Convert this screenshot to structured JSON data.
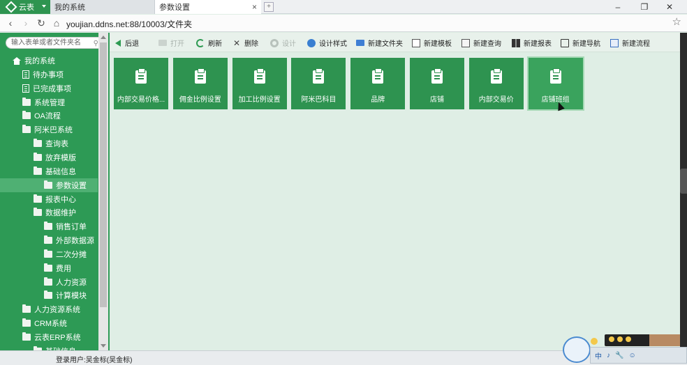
{
  "browser": {
    "app_tab_label": "云表",
    "tabs": [
      {
        "label": "我的系统"
      },
      {
        "label": "参数设置"
      }
    ],
    "close_glyph": "×",
    "address": "youjian.ddns.net:88/10003/文件夹"
  },
  "sidebar": {
    "search_placeholder": "输入表单或者文件夹名",
    "tree": [
      {
        "label": "我的系统",
        "icon": "home-icon",
        "level": 0
      },
      {
        "label": "待办事项",
        "icon": "doc-icon",
        "level": 1
      },
      {
        "label": "已完成事项",
        "icon": "doc-icon",
        "level": 1
      },
      {
        "label": "系统管理",
        "icon": "folder-icon",
        "level": 1
      },
      {
        "label": "OA流程",
        "icon": "folder-icon",
        "level": 1
      },
      {
        "label": "阿米巴系统",
        "icon": "folder-icon",
        "level": 1
      },
      {
        "label": "查询表",
        "icon": "folder-icon",
        "level": 2
      },
      {
        "label": "放弃模版",
        "icon": "folder-icon",
        "level": 2
      },
      {
        "label": "基础信息",
        "icon": "folder-icon",
        "level": 2
      },
      {
        "label": "参数设置",
        "icon": "folder-icon",
        "level": 3,
        "selected": true
      },
      {
        "label": "报表中心",
        "icon": "folder-icon",
        "level": 2
      },
      {
        "label": "数据维护",
        "icon": "folder-icon",
        "level": 2
      },
      {
        "label": "销售订单",
        "icon": "folder-icon",
        "level": 3
      },
      {
        "label": "外部数据源",
        "icon": "folder-icon",
        "level": 3
      },
      {
        "label": "二次分摊",
        "icon": "folder-icon",
        "level": 3
      },
      {
        "label": "费用",
        "icon": "folder-icon",
        "level": 3
      },
      {
        "label": "人力资源",
        "icon": "folder-icon",
        "level": 3
      },
      {
        "label": "计算模块",
        "icon": "folder-icon",
        "level": 3
      },
      {
        "label": "人力资源系统",
        "icon": "folder-icon",
        "level": 1
      },
      {
        "label": "CRM系统",
        "icon": "folder-icon",
        "level": 1
      },
      {
        "label": "云表ERP系统",
        "icon": "folder-icon",
        "level": 1
      },
      {
        "label": "基础信息",
        "icon": "folder-icon",
        "level": 2
      }
    ]
  },
  "toolbar": {
    "items": [
      {
        "label": "后退",
        "icon": "back-arrow-icon",
        "enabled": true
      },
      {
        "label": "打开",
        "icon": "open-folder-icon",
        "enabled": false
      },
      {
        "label": "刷新",
        "icon": "refresh-icon",
        "enabled": true
      },
      {
        "label": "删除",
        "icon": "delete-icon",
        "enabled": true
      },
      {
        "label": "设计",
        "icon": "design-gear-icon",
        "enabled": false
      },
      {
        "label": "设计样式",
        "icon": "palette-icon",
        "enabled": true
      },
      {
        "label": "新建文件夹",
        "icon": "new-folder-icon",
        "enabled": true
      },
      {
        "label": "新建模板",
        "icon": "new-template-icon",
        "enabled": true
      },
      {
        "label": "新建查询",
        "icon": "new-query-icon",
        "enabled": true
      },
      {
        "label": "新建报表",
        "icon": "new-report-icon",
        "enabled": true
      },
      {
        "label": "新建导航",
        "icon": "new-nav-icon",
        "enabled": true
      },
      {
        "label": "新建流程",
        "icon": "new-flow-icon",
        "enabled": true
      }
    ]
  },
  "tiles": [
    {
      "label": "内部交易价格..."
    },
    {
      "label": "佣金比例设置"
    },
    {
      "label": "加工比例设置"
    },
    {
      "label": "阿米巴科目"
    },
    {
      "label": "品牌"
    },
    {
      "label": "店铺"
    },
    {
      "label": "内部交易价"
    },
    {
      "label": "店铺班组",
      "hovered": true
    }
  ],
  "status": {
    "login_user": "登录用户:吴金标(吴金标)"
  },
  "tray": {
    "items": [
      "中",
      "♪",
      "🔧",
      "☺"
    ]
  },
  "colors": {
    "primary_green": "#2e9350",
    "sidebar_green": "#2d9a55",
    "content_bg": "#dfeee5"
  }
}
